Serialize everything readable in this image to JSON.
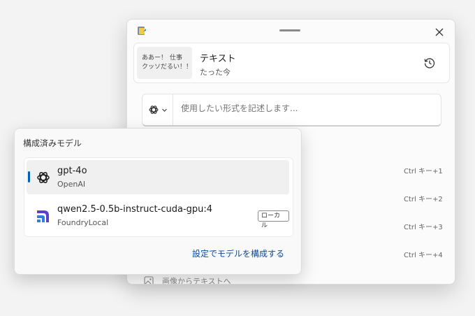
{
  "window": {
    "clipboard": {
      "thumb_line1_left": "ああー！",
      "thumb_line1_right": "仕事",
      "thumb_line2": "クッソだるい！！",
      "title": "テキスト",
      "time": "たった今"
    },
    "input_placeholder": "使用したい形式を記述します...",
    "shortcuts": [
      "Ctrl キー+1",
      "Ctrl キー+2",
      "Ctrl キー+3",
      "Ctrl キー+4"
    ],
    "image_to_text": "画像からテキストへ"
  },
  "dropdown": {
    "title": "構成済みモデル",
    "models": [
      {
        "name": "gpt-4o",
        "provider": "OpenAI",
        "icon": "openai-icon",
        "selected": true
      },
      {
        "name": "qwen2.5-0.5b-instruct-cuda-gpu:4",
        "provider": "FoundryLocal",
        "icon": "foundry-icon",
        "badge": "ローカル",
        "selected": false
      }
    ],
    "configure_link": "設定でモデルを構成する"
  },
  "colors": {
    "accent": "#005fb8",
    "link": "#0a4a9a",
    "foundry": "#5b3fd1"
  }
}
